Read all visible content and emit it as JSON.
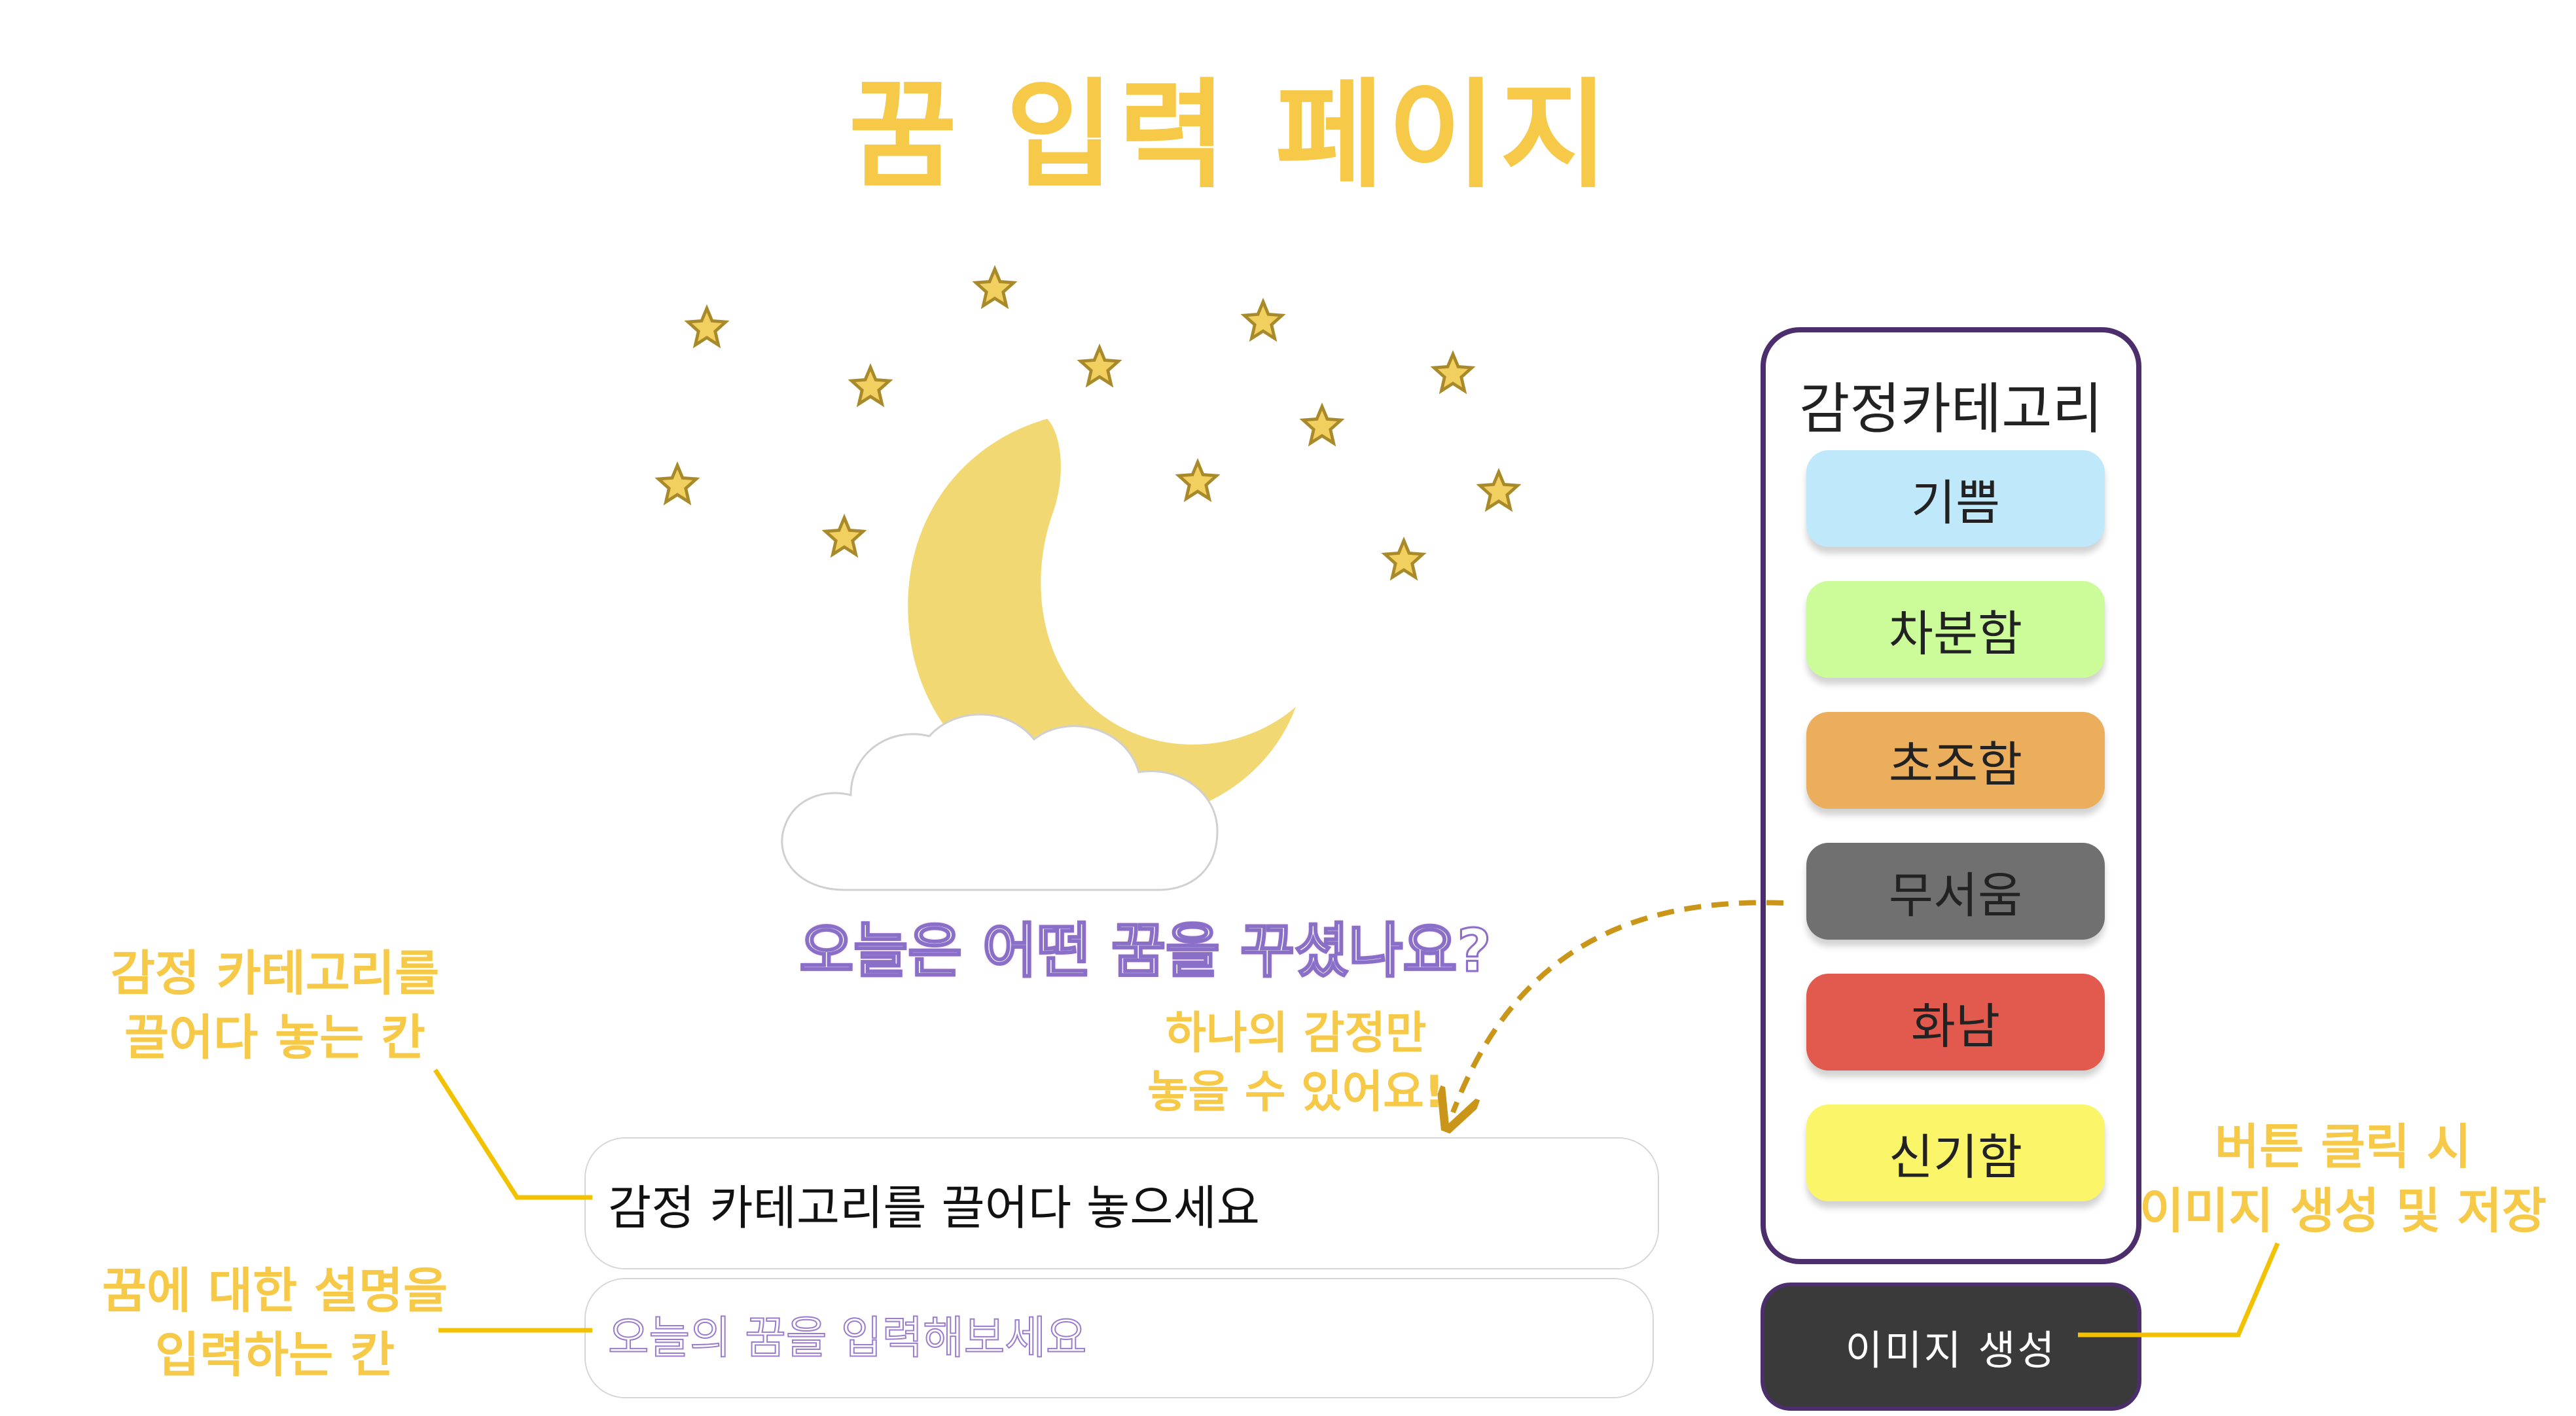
{
  "page": {
    "title": "꿈 입력 페이지"
  },
  "hero": {
    "question": "오늘은 어떤 꿈을 꾸셨나요?"
  },
  "inputs": {
    "drop_zone_text": "감정 카테고리를 끌어다 놓으세요",
    "dream_placeholder": "오늘의 꿈을 입력해보세요"
  },
  "category_panel": {
    "title": "감정카테고리",
    "items": [
      {
        "label": "기쁨",
        "color": "#bfe9fb"
      },
      {
        "label": "차분함",
        "color": "#ccfb9a"
      },
      {
        "label": "초조함",
        "color": "#ebae5c"
      },
      {
        "label": "무서움",
        "color": "#707070"
      },
      {
        "label": "화남",
        "color": "#e25a4e"
      },
      {
        "label": "신기함",
        "color": "#fbf569"
      }
    ]
  },
  "generate_button": {
    "label": "이미지 생성"
  },
  "annotations": {
    "drop_zone_line1": "감정 카테고리를",
    "drop_zone_line2": "끌어다 놓는 칸",
    "dream_input_line1": "꿈에 대한 설명을",
    "dream_input_line2": "입력하는 칸",
    "single_emotion_line1": "하나의 감정만",
    "single_emotion_line2": "놓을 수 있어요!",
    "button_line1": "버튼 클릭 시",
    "button_line2": "이미지 생성 및 저장"
  },
  "colors": {
    "accent": "#f7c948",
    "panel_border": "#4b2e6b",
    "button_bg": "#3a3a3a",
    "moon": "#f2d872",
    "arrow": "#c9961a"
  }
}
